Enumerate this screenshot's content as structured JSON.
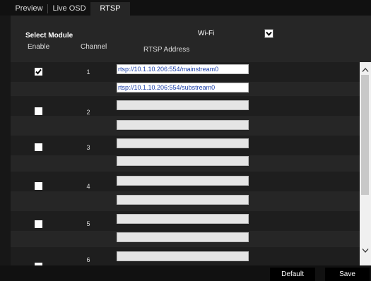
{
  "tabs": [
    {
      "label": "Preview"
    },
    {
      "label": "Live OSD"
    },
    {
      "label": "RTSP"
    }
  ],
  "form": {
    "select_module_label": "Select Module",
    "module_value": "Wi-Fi"
  },
  "headers": {
    "enable": "Enable",
    "channel": "Channel",
    "rtsp_address": "RTSP Address"
  },
  "channels": [
    {
      "number": "1",
      "enabled": true,
      "main": "rtsp://10.1.10.206:554/mainstream0",
      "sub": "rtsp://10.1.10.206:554/substream0"
    },
    {
      "number": "2",
      "enabled": false,
      "main": "",
      "sub": ""
    },
    {
      "number": "3",
      "enabled": false,
      "main": "",
      "sub": ""
    },
    {
      "number": "4",
      "enabled": false,
      "main": "",
      "sub": ""
    },
    {
      "number": "5",
      "enabled": false,
      "main": "",
      "sub": ""
    },
    {
      "number": "6",
      "enabled": false,
      "main": "",
      "sub": ""
    }
  ],
  "footer": {
    "default_label": "Default",
    "save_label": "Save"
  }
}
